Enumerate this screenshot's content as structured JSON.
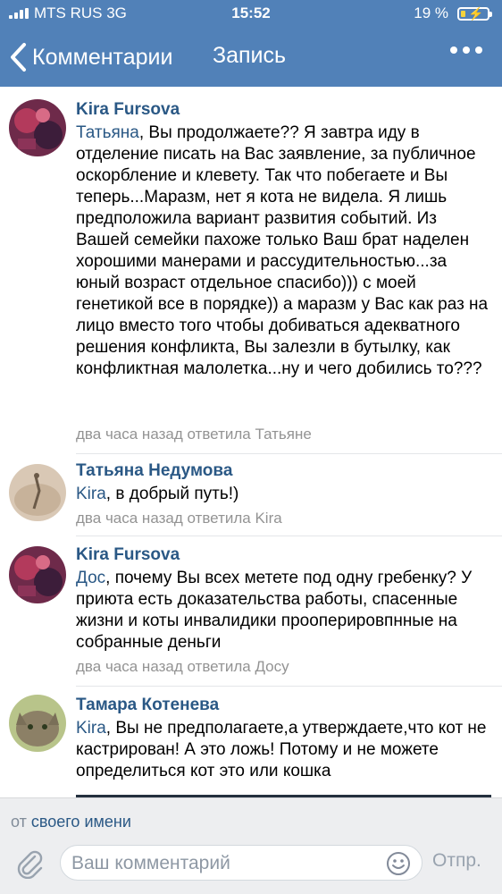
{
  "status_bar": {
    "carrier": "MTS RUS  3G",
    "time": "15:52",
    "battery_text": "19 %",
    "battery_level": 0.19
  },
  "nav": {
    "back_label": "Комментарии",
    "title": "Запись",
    "icons": {
      "back": "chevron-left-icon",
      "more": "more-dots-icon"
    }
  },
  "comments": [
    {
      "author": "Kira Fursova",
      "mention": "Татьяна",
      "text": ", Вы продолжаете?? Я завтра иду в отделение писать на Вас заявление, за публичное оскорбление и клевету. Так что побегаете и Вы теперь...Маразм, нет я кота не видела. Я лишь предположила вариант развития событий. Из Вашей семейки пахоже только Ваш брат наделен хорошими манерами и рассудительностью...за юный возраст отдельное спасибо))) с моей генетикой все в порядке)) а маразм у Вас как раз на лицо вместо того чтобы добиваться адекватного решения конфликта, Вы залезли в бутылку, как конфликтная малолетка...ну и чего добились то???",
      "meta": "два часа назад ответила Татьяне"
    },
    {
      "author": "Татьяна Недумова",
      "mention": "Kira",
      "text": ", в добрый путь!)",
      "meta": "два часа назад ответила Kira"
    },
    {
      "author": "Kira Fursova",
      "mention": "Дос",
      "text": ", почему Вы всех метете под одну гребенку? У приюта есть доказательства работы, спасенные жизни и коты инвалидики прооперировпнные на собранные деньги",
      "meta": "два часа назад ответила Досу"
    },
    {
      "author": "Тамара Котенева",
      "mention": "Kira",
      "text": ", Вы не предполагаете,а утверждаете,что кот не кастрирован! А это ложь! Потому и не можете определиться кот это или кошка",
      "meta": ""
    }
  ],
  "footer": {
    "from_prefix": "от",
    "from_link": "своего имени",
    "input_placeholder": "Ваш комментарий",
    "input_value": "",
    "send_label": "Отпр.",
    "icons": {
      "attach": "paperclip-icon",
      "emoji": "smile-icon"
    }
  },
  "colors": {
    "header_bg": "#5181b8",
    "link": "#2a5885",
    "meta": "#939393",
    "footer_bg": "#edeef0"
  }
}
